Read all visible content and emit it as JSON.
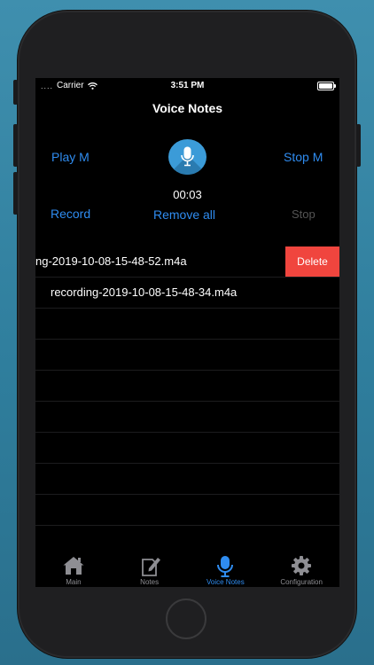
{
  "status_bar": {
    "carrier": "Carrier",
    "signal_dots": "....",
    "time": "3:51 PM"
  },
  "nav": {
    "title": "Voice Notes"
  },
  "controls": {
    "play_label": "Play M",
    "stop_m_label": "Stop M",
    "record_label": "Record",
    "remove_all_label": "Remove all",
    "stop_label": "Stop",
    "timer": "00:03"
  },
  "recordings": [
    {
      "name": "ng-2019-10-08-15-48-52.m4a",
      "delete_label": "Delete"
    },
    {
      "name": "recording-2019-10-08-15-48-34.m4a"
    }
  ],
  "tab_bar": {
    "tabs": [
      {
        "label": "Main",
        "icon": "house-icon"
      },
      {
        "label": "Notes",
        "icon": "notes-edit-icon"
      },
      {
        "label": "Voice Notes",
        "icon": "microphone-icon",
        "active": true
      },
      {
        "label": "Configuration",
        "icon": "gear-icon"
      }
    ]
  },
  "colors": {
    "accent": "#2f8cf0",
    "delete": "#f0453e",
    "mic_button": "#3b9bd8",
    "background": "#3f8fae"
  }
}
